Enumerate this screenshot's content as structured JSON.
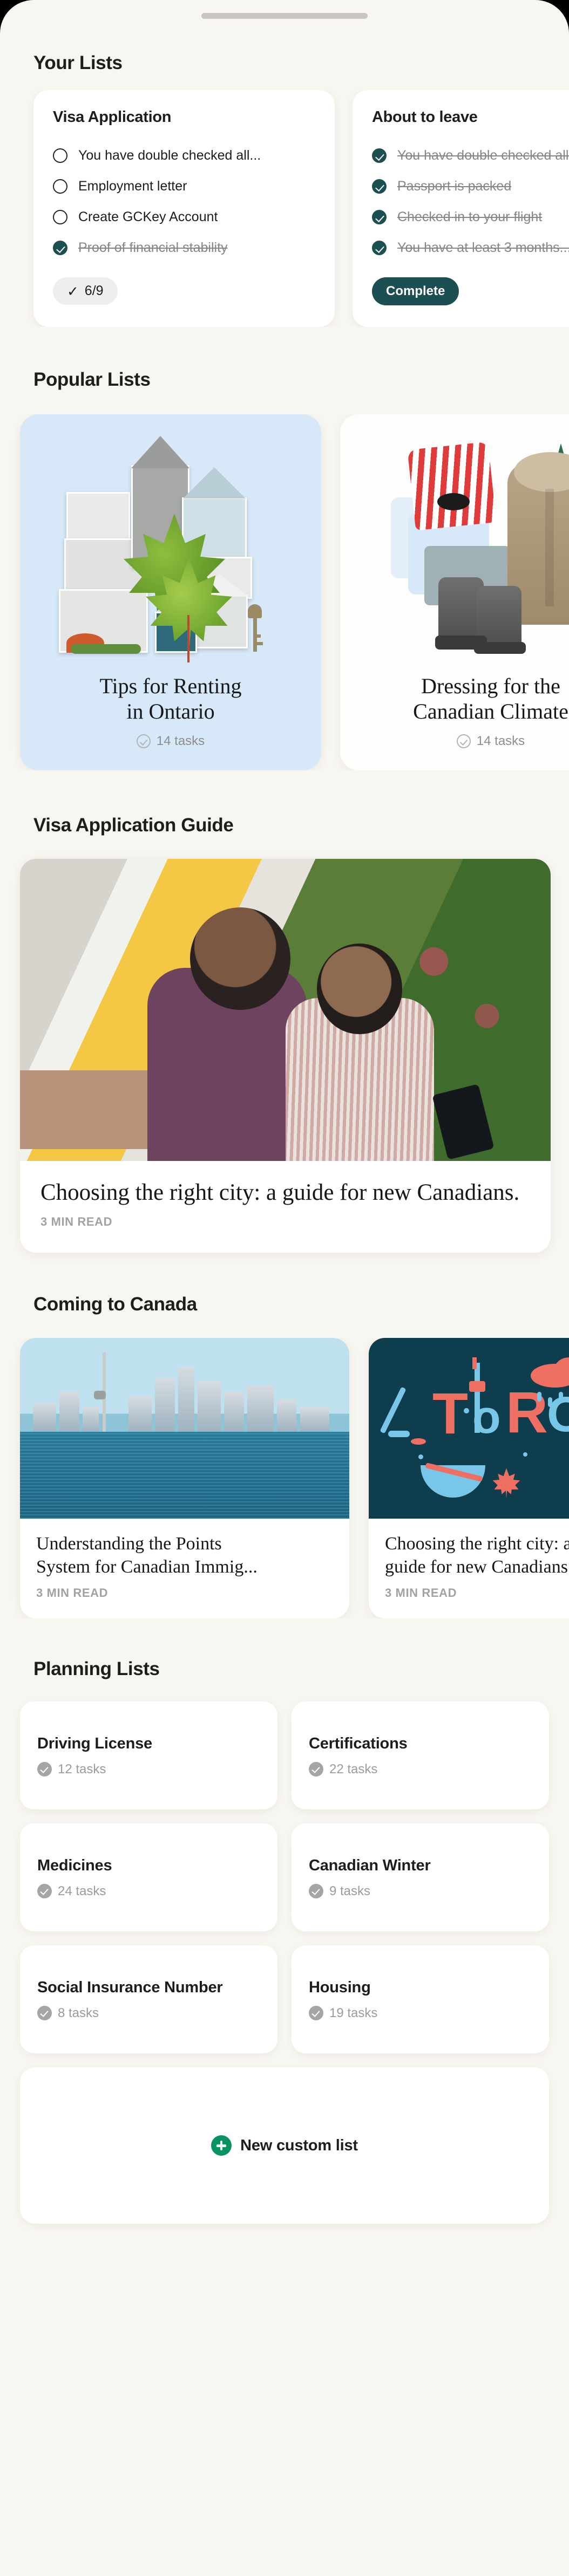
{
  "sheet": {
    "grabber": "drag-handle"
  },
  "your_lists": {
    "heading": "Your Lists",
    "cards": [
      {
        "title": "Visa Application",
        "items": [
          {
            "label": "You have double checked all...",
            "done": false
          },
          {
            "label": "Employment letter",
            "done": false
          },
          {
            "label": "Create GCKey Account",
            "done": false
          },
          {
            "label": "Proof of financial stability",
            "done": true
          }
        ],
        "badge_type": "count",
        "badge_tick": "✓",
        "badge_label": "6/9"
      },
      {
        "title": "About to leave",
        "items": [
          {
            "label": "You have double checked all...",
            "done": true
          },
          {
            "label": "Passport is packed",
            "done": true
          },
          {
            "label": "Checked in to your flight",
            "done": true
          },
          {
            "label": "You have at least 3 months...",
            "done": true
          }
        ],
        "badge_type": "complete",
        "badge_label": "Complete"
      }
    ]
  },
  "popular_lists": {
    "heading": "Popular Lists",
    "cards": [
      {
        "title": "Tips for Renting\nin Ontario",
        "tasks": "14 tasks",
        "art": "houses-maple-key",
        "bg": "#d7e8f8"
      },
      {
        "title": "Dressing for the\nCanadian Climate",
        "tasks": "14 tasks",
        "art": "coat-boots-swimsuit",
        "bg": "#fdfdfc"
      }
    ]
  },
  "visa_guide": {
    "heading": "Visa Application Guide",
    "article": {
      "title": "Choosing the right city: a guide for new Canadians.",
      "read_time": "3 MIN READ",
      "image": "couple-looking-at-phone-photo"
    }
  },
  "coming_to_canada": {
    "heading": "Coming to Canada",
    "articles": [
      {
        "title": "Understanding the Points\nSystem for Canadian Immig...",
        "read_time": "3 MIN READ",
        "image": "toronto-skyline-photo"
      },
      {
        "title": "Choosing the right city: a\nguide for new Canadians.",
        "read_time": "3 MIN READ",
        "image": "toronto-lettering-illustration"
      }
    ]
  },
  "planning_lists": {
    "heading": "Planning Lists",
    "cards": [
      {
        "name": "Driving License",
        "tasks": "12 tasks"
      },
      {
        "name": "Certifications",
        "tasks": "22 tasks"
      },
      {
        "name": "Medicines",
        "tasks": "24 tasks"
      },
      {
        "name": "Canadian Winter",
        "tasks": "9 tasks"
      },
      {
        "name": "Social Insurance Number",
        "tasks": "8 tasks"
      },
      {
        "name": "Housing",
        "tasks": "19 tasks"
      }
    ],
    "new_list_label": "New custom list"
  },
  "colors": {
    "sheet_bg": "#f8f6f0",
    "card_white": "#ffffff",
    "teal": "#1c4f52",
    "popular_blue": "#d7e8f8",
    "green_accent": "#089360",
    "muted_text": "#9b9b9b",
    "dark_text": "#1d1d1b",
    "toronto_navy": "#0e3d4d"
  }
}
